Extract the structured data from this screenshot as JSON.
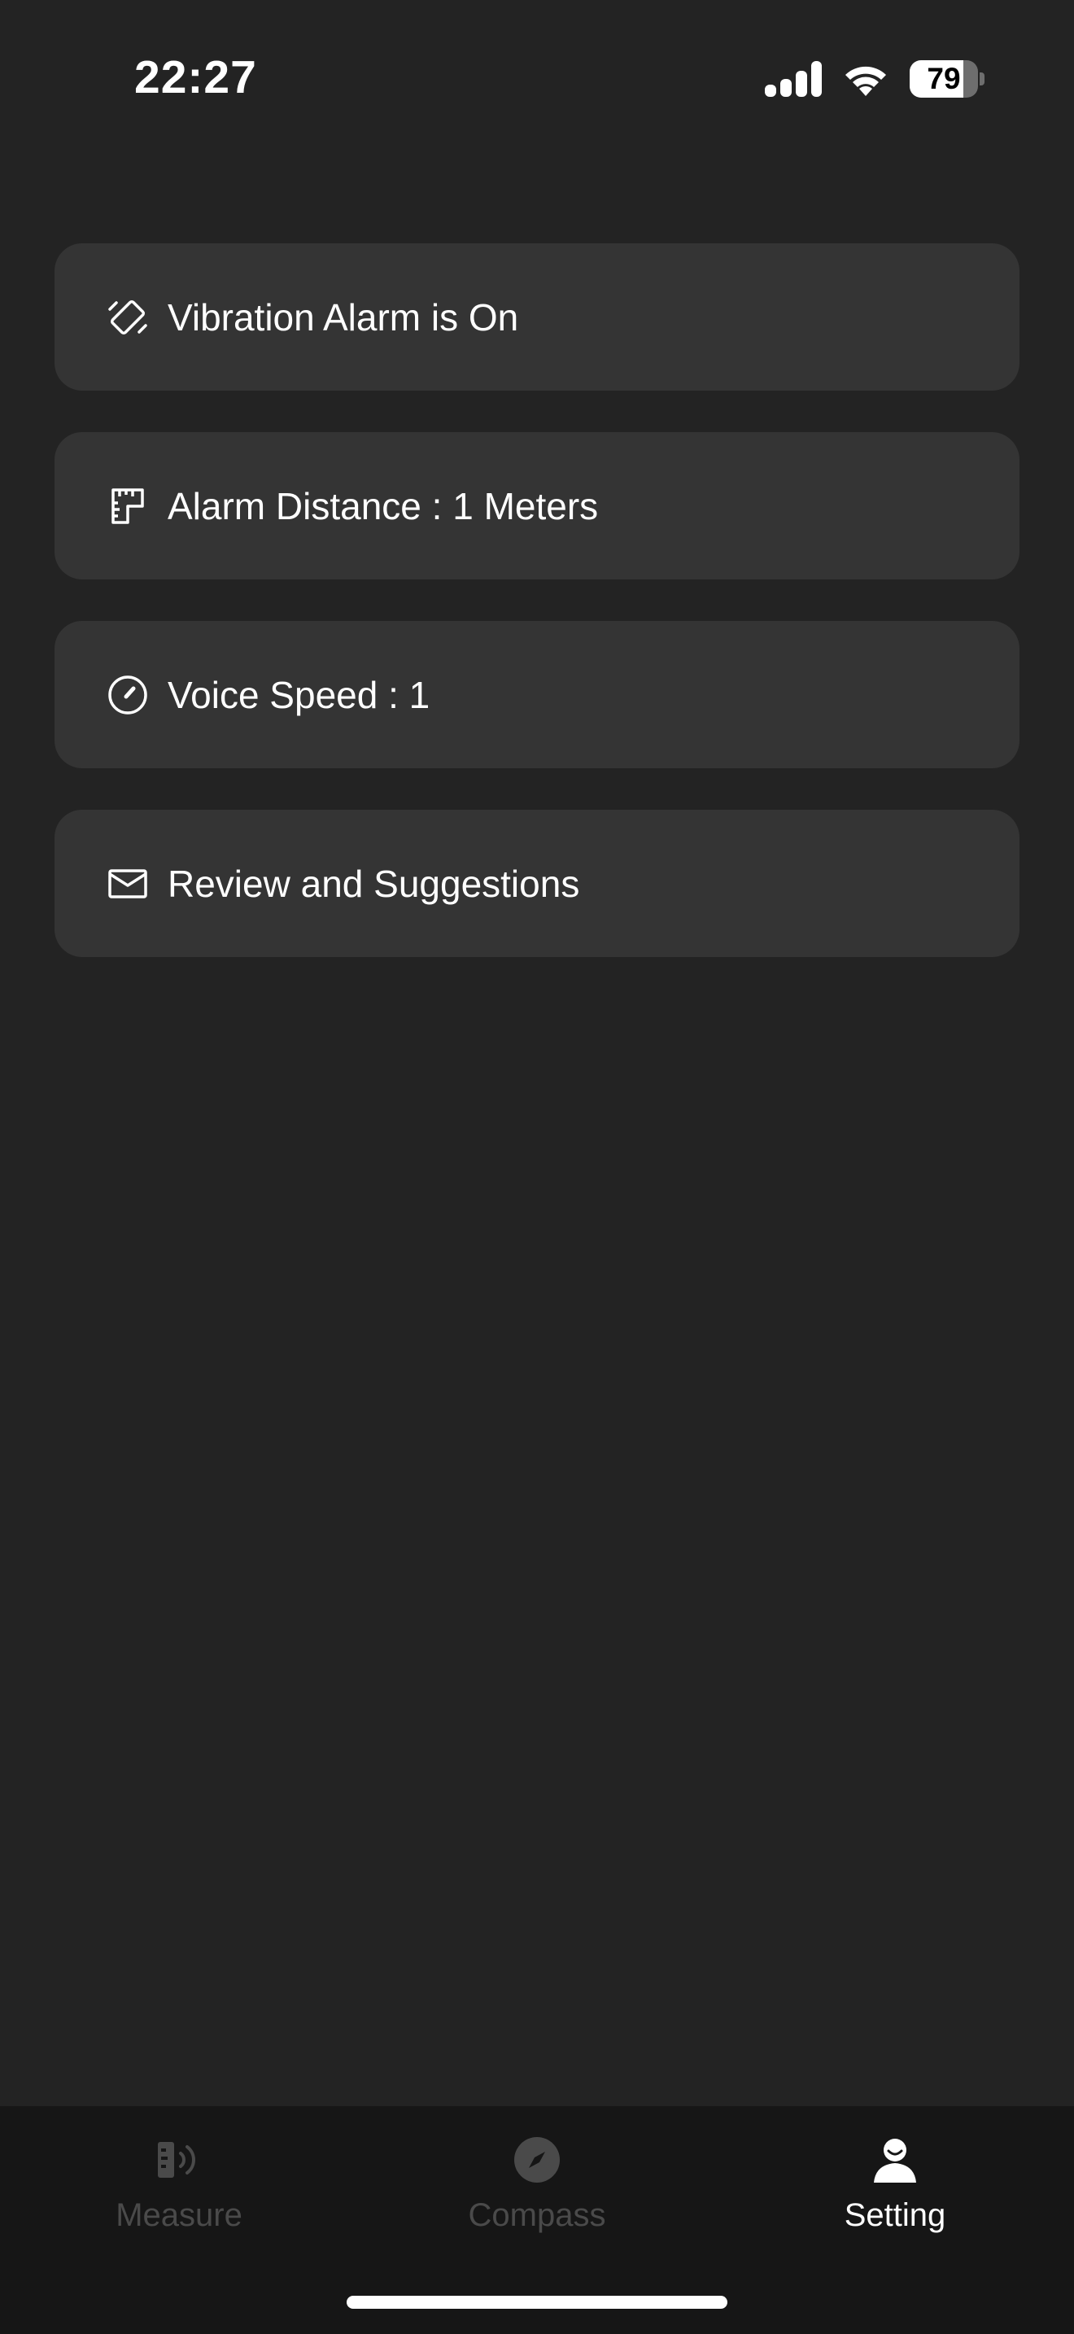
{
  "status_bar": {
    "time": "22:27",
    "battery": "79",
    "battery_level": 0.79
  },
  "settings": [
    {
      "icon": "vibration-icon",
      "label": "Vibration Alarm is On"
    },
    {
      "icon": "ruler-icon",
      "label": "Alarm Distance : 1 Meters"
    },
    {
      "icon": "speedometer-icon",
      "label": "Voice Speed : 1"
    },
    {
      "icon": "mail-icon",
      "label": "Review and Suggestions"
    }
  ],
  "tabs": [
    {
      "icon": "measure-icon",
      "label": "Measure",
      "active": false
    },
    {
      "icon": "compass-icon",
      "label": "Compass",
      "active": false
    },
    {
      "icon": "person-icon",
      "label": "Setting",
      "active": true
    }
  ],
  "colors": {
    "background": "#232323",
    "card": "#343434",
    "tab_bar": "#161616",
    "tab_inactive": "#4a4a4a",
    "tab_active": "#ffffff"
  }
}
